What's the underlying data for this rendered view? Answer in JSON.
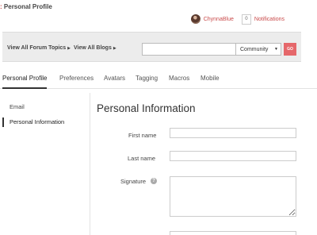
{
  "header": {
    "page_title": "Personal Profile",
    "title_prefix": ":",
    "username": "ChynnaBlue",
    "notification_count": "0",
    "notifications_label": "Notifications"
  },
  "nav": {
    "forum_topics": "View All Forum Topics",
    "blogs": "View All Blogs",
    "search_value": "",
    "scope_selected": "Community",
    "go_label": "GO",
    "arrow_icon": "triangle-right",
    "caret_icon": "triangle-down"
  },
  "tabs": [
    {
      "label": "Personal Profile",
      "active": true
    },
    {
      "label": "Preferences"
    },
    {
      "label": "Avatars"
    },
    {
      "label": "Tagging"
    },
    {
      "label": "Macros"
    },
    {
      "label": "Mobile"
    }
  ],
  "sidebar": {
    "items": [
      {
        "label": "Email"
      },
      {
        "label": "Personal Information",
        "active": true
      }
    ]
  },
  "main": {
    "section_title": "Personal Information",
    "fields": {
      "first_name_label": "First name",
      "first_name_value": "",
      "last_name_label": "Last name",
      "last_name_value": "",
      "signature_label": "Signature",
      "signature_value": "",
      "help_icon": "?"
    }
  },
  "colors": {
    "accent": "#c94a4a",
    "go_button": "#e5676a",
    "nav_bg": "#ececec"
  }
}
